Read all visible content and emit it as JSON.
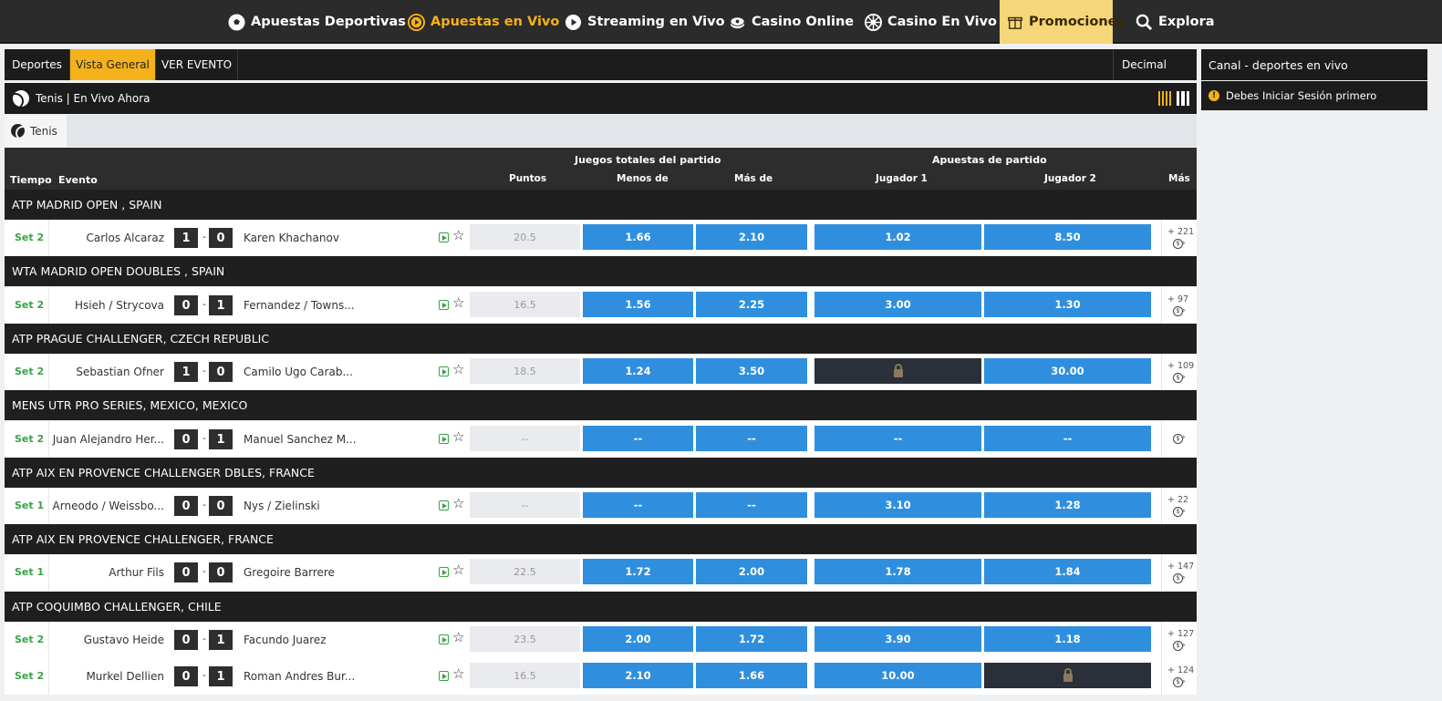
{
  "nav": [
    {
      "label": "Apuestas Deportivas",
      "icon": "soccer-ball-icon"
    },
    {
      "label": "Apuestas en Vivo",
      "icon": "live-play-icon"
    },
    {
      "label": "Streaming en Vivo",
      "icon": "stream-play-icon"
    },
    {
      "label": "Casino Online",
      "icon": "casino-chip-icon"
    },
    {
      "label": "Casino En Vivo",
      "icon": "roulette-icon"
    },
    {
      "label": "Promociones",
      "icon": "gift-icon"
    },
    {
      "label": "Explora",
      "icon": "search-icon"
    }
  ],
  "tabs": {
    "deportes": "Deportes",
    "vista_general": "Vista General",
    "ver_evento": "VER EVENTO",
    "odds_format": "Decimal"
  },
  "sport_bar": {
    "title": "Tenis | En Vivo Ahora"
  },
  "sub_tab": {
    "label": "Tenis"
  },
  "table_header": {
    "group_totals": "Juegos totales del partido",
    "group_match": "Apuestas de partido",
    "tiempo": "Tiempo",
    "evento": "Evento",
    "puntos": "Puntos",
    "menos_de": "Menos de",
    "mas_de": "Más de",
    "jugador1": "Jugador 1",
    "jugador2": "Jugador 2",
    "mas": "Más"
  },
  "leagues": [
    {
      "name": "ATP MADRID OPEN , SPAIN"
    },
    {
      "name": "WTA MADRID OPEN DOUBLES , SPAIN"
    },
    {
      "name": "ATP PRAGUE CHALLENGER, CZECH REPUBLIC"
    },
    {
      "name": "MENS UTR PRO SERIES, MEXICO, MEXICO"
    },
    {
      "name": "ATP AIX EN PROVENCE CHALLENGER DBLES, FRANCE"
    },
    {
      "name": "ATP AIX EN PROVENCE CHALLENGER, FRANCE"
    },
    {
      "name": "ATP COQUIMBO CHALLENGER, CHILE"
    }
  ],
  "matches": [
    {
      "set": "Set 2",
      "p1": "Carlos Alcaraz",
      "s1": "1",
      "s2": "0",
      "p2": "Karen Khachanov",
      "pts": "20.5",
      "under": "1.66",
      "over": "2.10",
      "j1": "1.02",
      "j2": "8.50",
      "more": "+ 221"
    },
    {
      "set": "Set 2",
      "p1": "Hsieh / Strycova",
      "s1": "0",
      "s2": "1",
      "p2": "Fernandez / Towns...",
      "pts": "16.5",
      "under": "1.56",
      "over": "2.25",
      "j1": "3.00",
      "j2": "1.30",
      "more": "+ 97"
    },
    {
      "set": "Set 2",
      "p1": "Sebastian Ofner",
      "s1": "1",
      "s2": "0",
      "p2": "Camilo Ugo Carab...",
      "pts": "18.5",
      "under": "1.24",
      "over": "3.50",
      "j1": "",
      "j2": "30.00",
      "more": "+ 109"
    },
    {
      "set": "Set 2",
      "p1": "Juan Alejandro Her...",
      "s1": "0",
      "s2": "1",
      "p2": "Manuel Sanchez M...",
      "pts": "--",
      "under": "--",
      "over": "--",
      "j1": "--",
      "j2": "--",
      "more": ""
    },
    {
      "set": "Set 1",
      "p1": "Arneodo / Weissbo...",
      "s1": "0",
      "s2": "0",
      "p2": "Nys / Zielinski",
      "pts": "--",
      "under": "--",
      "over": "--",
      "j1": "3.10",
      "j2": "1.28",
      "more": "+ 22"
    },
    {
      "set": "Set 1",
      "p1": "Arthur Fils",
      "s1": "0",
      "s2": "0",
      "p2": "Gregoire Barrere",
      "pts": "22.5",
      "under": "1.72",
      "over": "2.00",
      "j1": "1.78",
      "j2": "1.84",
      "more": "+ 147"
    },
    {
      "set": "Set 2",
      "p1": "Gustavo Heide",
      "s1": "0",
      "s2": "1",
      "p2": "Facundo Juarez",
      "pts": "23.5",
      "under": "2.00",
      "over": "1.72",
      "j1": "3.90",
      "j2": "1.18",
      "more": "+ 127"
    },
    {
      "set": "Set 2",
      "p1": "Murkel Dellien",
      "s1": "0",
      "s2": "1",
      "p2": "Roman Andres Bur...",
      "pts": "16.5",
      "under": "2.10",
      "over": "1.66",
      "j1": "10.00",
      "j2": "",
      "more": "+ 124"
    }
  ],
  "right_panel": {
    "title": "Canal - deportes en vivo",
    "message": "Debes Iniciar Sesión primero"
  },
  "colors": {
    "accent": "#f5b11a",
    "odds": "#2f8fde",
    "set": "#3aa14a"
  }
}
